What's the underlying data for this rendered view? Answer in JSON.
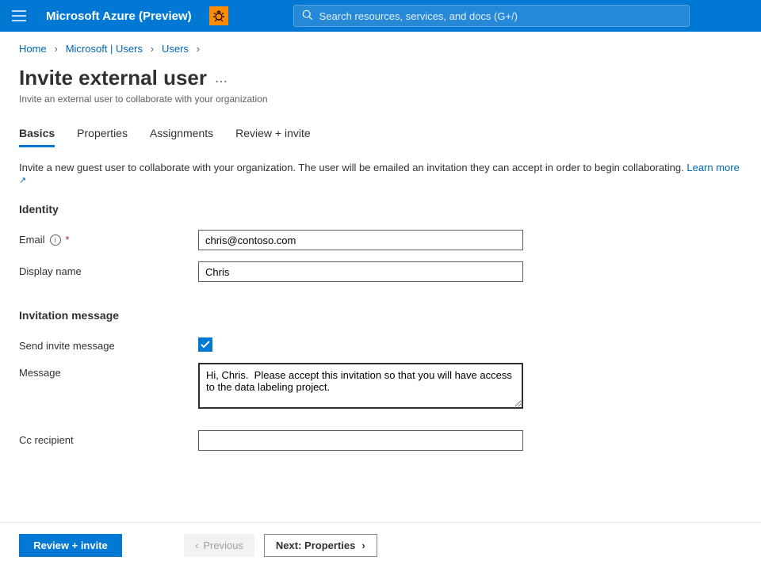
{
  "topbar": {
    "brand": "Microsoft Azure (Preview)",
    "search_placeholder": "Search resources, services, and docs (G+/)"
  },
  "breadcrumbs": {
    "items": [
      "Home",
      "Microsoft | Users",
      "Users"
    ]
  },
  "page": {
    "title": "Invite external user",
    "subtitle": "Invite an external user to collaborate with your organization"
  },
  "tabs": {
    "items": [
      "Basics",
      "Properties",
      "Assignments",
      "Review + invite"
    ],
    "active_index": 0
  },
  "description": {
    "text": "Invite a new guest user to collaborate with your organization. The user will be emailed an invitation they can accept in order to begin collaborating. ",
    "link": "Learn more"
  },
  "sections": {
    "identity": {
      "title": "Identity",
      "email_label": "Email",
      "email_value": "chris@contoso.com",
      "display_name_label": "Display name",
      "display_name_value": "Chris"
    },
    "invitation": {
      "title": "Invitation message",
      "send_label": "Send invite message",
      "send_checked": true,
      "message_label": "Message",
      "message_value": "Hi, Chris.  Please accept this invitation so that you will have access to the data labeling project.",
      "cc_label": "Cc recipient",
      "cc_value": ""
    }
  },
  "footer": {
    "review_label": "Review + invite",
    "prev_label": "Previous",
    "next_label": "Next: Properties"
  }
}
